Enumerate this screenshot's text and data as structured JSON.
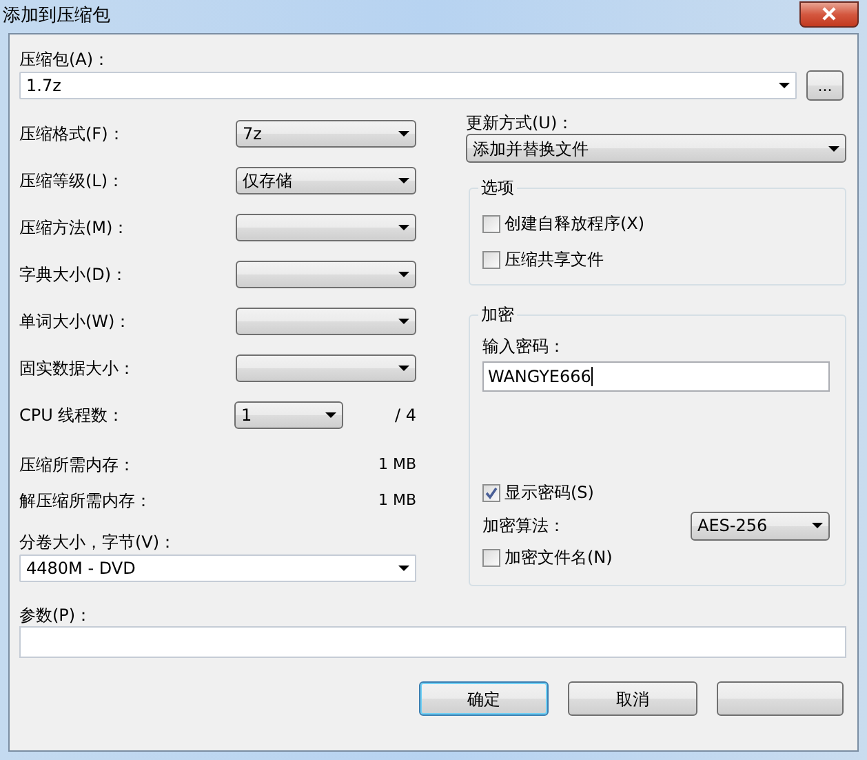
{
  "window": {
    "title": "添加到压缩包"
  },
  "archive": {
    "label": "压缩包(A)：",
    "value": "1.7z",
    "browse_button": "..."
  },
  "settings": [
    {
      "label": "压缩格式(F)：",
      "value": "7z"
    },
    {
      "label": "压缩等级(L)：",
      "value": "仅存储"
    },
    {
      "label": "压缩方法(M)："
    },
    {
      "label": "字典大小(D)："
    },
    {
      "label": "单词大小(W)："
    },
    {
      "label": "固实数据大小："
    }
  ],
  "cpu": {
    "label": "CPU 线程数：",
    "value": "1",
    "max": "/ 4"
  },
  "memory": [
    {
      "label": "压缩所需内存：",
      "value": "1 MB"
    },
    {
      "label": "解压缩所需内存：",
      "value": "1 MB"
    }
  ],
  "split": {
    "label": "分卷大小，字节(V)：",
    "value": "4480M - DVD"
  },
  "parameters": {
    "label": "参数(P)："
  },
  "update": {
    "label": "更新方式(U)：",
    "value": "添加并替换文件"
  },
  "options": {
    "title": "选项",
    "items": [
      {
        "label": "创建自释放程序(X)",
        "checked": false
      },
      {
        "label": "压缩共享文件",
        "checked": false
      }
    ]
  },
  "encryption": {
    "title": "加密",
    "password_label": "输入密码：",
    "password": "WANGYE666",
    "show_password": {
      "label": "显示密码(S)",
      "checked": true
    },
    "method_label": "加密算法：",
    "method": "AES-256",
    "encrypt_names": {
      "label": "加密文件名(N)",
      "checked": false
    }
  },
  "buttons": [
    {
      "label": "确定",
      "default": true
    },
    {
      "label": "取消",
      "default": false
    }
  ]
}
